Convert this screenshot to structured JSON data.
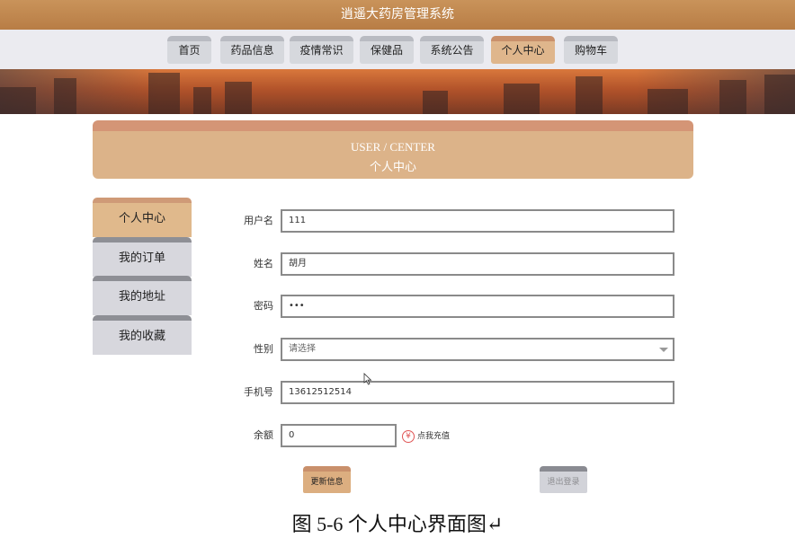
{
  "app": {
    "title": "逍遥大药房管理系统"
  },
  "nav": {
    "items": [
      {
        "label": "首页"
      },
      {
        "label": "药品信息"
      },
      {
        "label": "疫情常识"
      },
      {
        "label": "保健品"
      },
      {
        "label": "系统公告"
      },
      {
        "label": "个人中心",
        "active": true
      },
      {
        "label": "购物车"
      }
    ]
  },
  "header": {
    "title_en": "USER / CENTER",
    "title_zh": "个人中心"
  },
  "sidebar": {
    "items": [
      {
        "label": "个人中心",
        "active": true
      },
      {
        "label": "我的订单"
      },
      {
        "label": "我的地址"
      },
      {
        "label": "我的收藏"
      }
    ]
  },
  "form": {
    "username": {
      "label": "用户名",
      "value": "111"
    },
    "name": {
      "label": "姓名",
      "value": "胡月"
    },
    "password": {
      "label": "密码",
      "value": "•••"
    },
    "gender": {
      "label": "性别",
      "placeholder": "请选择"
    },
    "phone": {
      "label": "手机号",
      "value": "13612512514"
    },
    "balance": {
      "label": "余额",
      "value": "0"
    },
    "recharge": {
      "symbol": "¥",
      "label": "点我充值"
    }
  },
  "buttons": {
    "update": "更新信息",
    "logout": "退出登录"
  },
  "caption": {
    "text": "图 5-6 个人中心界面图↵"
  },
  "colors": {
    "brand": "#c08a55",
    "accent_tab": "#dfb68c",
    "inactive_tab": "#d6d8dd",
    "recharge_icon": "#e05555"
  },
  "icons": {
    "recharge": "yen-icon",
    "select": "chevron-down-icon",
    "cursor": "mouse-pointer-icon"
  }
}
